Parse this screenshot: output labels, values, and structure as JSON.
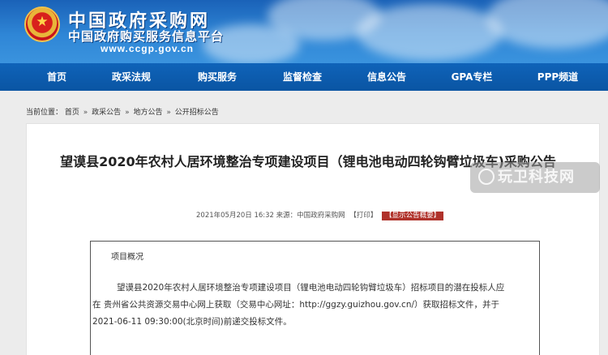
{
  "header": {
    "title": "中国政府采购网",
    "subtitle": "中国政府购买服务信息平台",
    "domain": "www.ccgp.gov.cn"
  },
  "nav": {
    "items": [
      {
        "label": "首页"
      },
      {
        "label": "政采法规"
      },
      {
        "label": "购买服务"
      },
      {
        "label": "监督检查"
      },
      {
        "label": "信息公告"
      },
      {
        "label": "GPA专栏"
      },
      {
        "label": "PPP频道"
      }
    ]
  },
  "breadcrumb": {
    "prefix": "当前位置：",
    "items": [
      "首页",
      "政采公告",
      "地方公告",
      "公开招标公告"
    ],
    "separator": "»"
  },
  "article": {
    "title": "望谟县2020年农村人居环境整治专项建设项目（锂电池电动四轮钩臂垃圾车)采购公告",
    "meta": "2021年05月20日 16:32 来源：中国政府采购网",
    "print_label": "【打印】",
    "summary_button": "【显示公告概要】",
    "section_heading": "项目概况",
    "paragraph_lines": [
      "望谟县2020年农村人居环境整治专项建设项目（锂电池电动四轮钩臂垃圾车）招标项目的潜在投标人应",
      "在 贵州省公共资源交易中心网上获取（交易中心网址：http://ggzy.guizhou.gov.cn/）获取招标文件，并于",
      "2021-06-11 09:30:00(北京时间)前递交投标文件。"
    ]
  },
  "watermark": {
    "text": "玩卫科技网"
  },
  "colors": {
    "banner": "#2f86d6",
    "navbar": "#0a55a3",
    "summary_button": "#b0322b"
  }
}
